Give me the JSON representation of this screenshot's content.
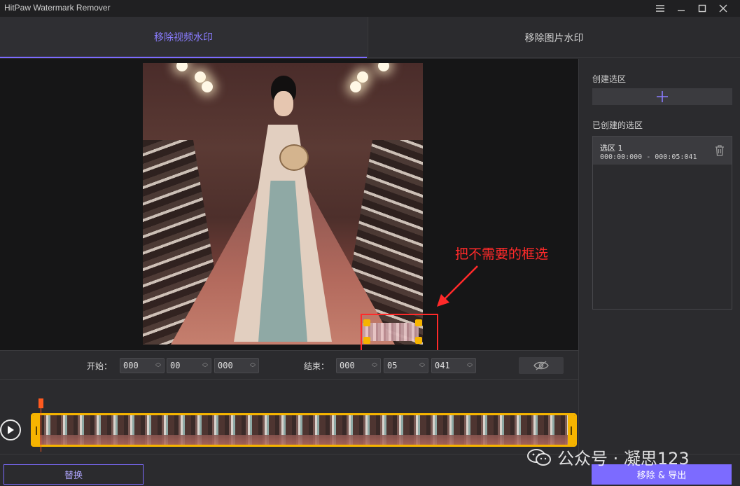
{
  "window": {
    "title": "HitPaw Watermark Remover",
    "menu_icon": "hamburger-icon",
    "minimize_icon": "minimize-icon",
    "maximize_icon": "maximize-icon",
    "close_icon": "close-icon"
  },
  "tabs": [
    {
      "label": "移除视频水印",
      "active": true
    },
    {
      "label": "移除图片水印",
      "active": false
    }
  ],
  "annotation": {
    "text": "把不需要的框选",
    "color": "#ff2a2a"
  },
  "time": {
    "start_label": "开始：",
    "start": [
      "000",
      "00",
      "000"
    ],
    "end_label": "结束：",
    "end": [
      "000",
      "05",
      "041"
    ]
  },
  "right_panel": {
    "create_label": "创建选区",
    "created_label": "已创建的选区",
    "selections": [
      {
        "title": "选区 1",
        "range": "000:00:000 - 000:05:041"
      }
    ]
  },
  "bottom": {
    "replace_label": "替换",
    "export_label": "移除 & 导出",
    "credit": "公众号 · 凝思123"
  },
  "colors": {
    "accent": "#7c6bff",
    "handle": "#f6b400",
    "playhead": "#ff5a1f"
  }
}
